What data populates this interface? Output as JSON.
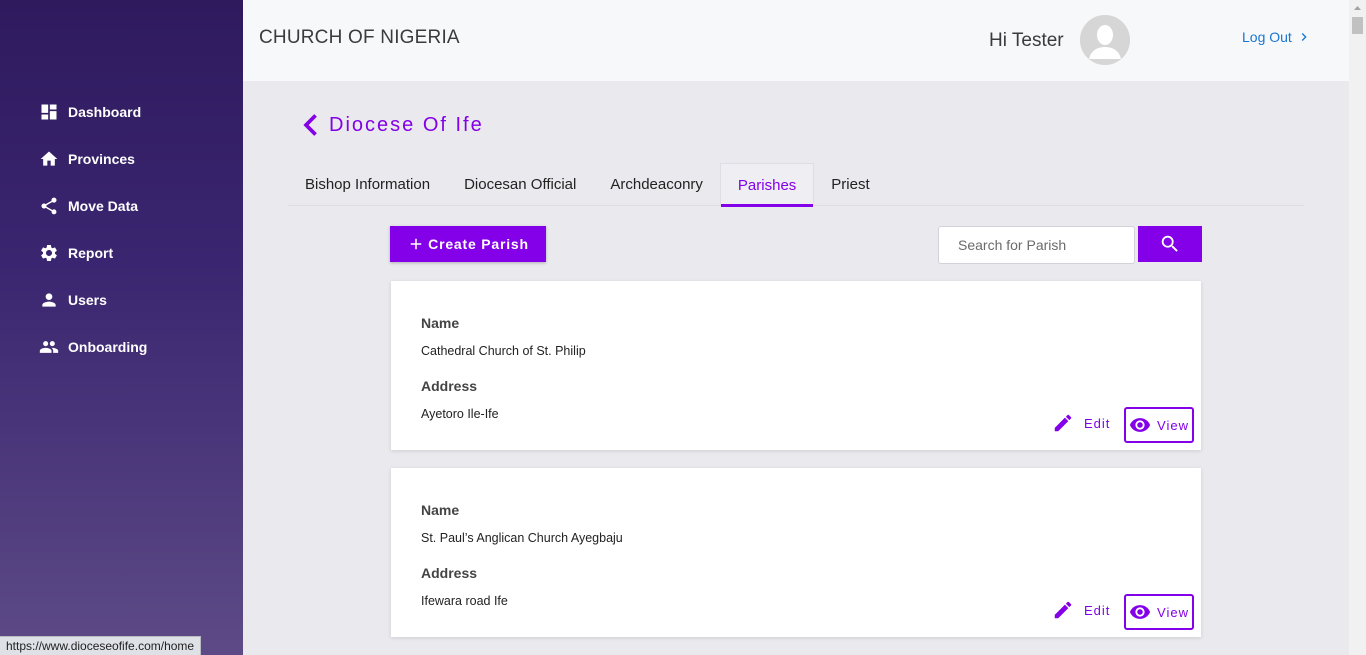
{
  "sidebar": {
    "items": [
      {
        "label": "Dashboard",
        "icon": "dashboard-icon"
      },
      {
        "label": "Provinces",
        "icon": "home-icon"
      },
      {
        "label": "Move Data",
        "icon": "share-icon"
      },
      {
        "label": "Report",
        "icon": "gear-icon"
      },
      {
        "label": "Users",
        "icon": "person-icon"
      },
      {
        "label": "Onboarding",
        "icon": "people-icon"
      }
    ]
  },
  "header": {
    "title": "CHURCH OF NIGERIA",
    "greeting": "Hi Tester",
    "logout_label": "Log Out"
  },
  "page": {
    "title": "Diocese Of Ife"
  },
  "tabs": [
    {
      "label": "Bishop Information",
      "active": false
    },
    {
      "label": "Diocesan Official",
      "active": false
    },
    {
      "label": "Archdeaconry",
      "active": false
    },
    {
      "label": "Parishes",
      "active": true
    },
    {
      "label": "Priest",
      "active": false
    }
  ],
  "toolbar": {
    "create_label": "Create Parish",
    "search_placeholder": "Search for Parish"
  },
  "parishes": [
    {
      "name_label": "Name",
      "name": "Cathedral Church of St. Philip",
      "address_label": "Address",
      "address": "Ayetoro Ile-Ife",
      "edit_label": "Edit",
      "view_label": "View"
    },
    {
      "name_label": "Name",
      "name": "St. Paul’s Anglican Church Ayegbaju",
      "address_label": "Address",
      "address": "Ifewara road Ife",
      "edit_label": "Edit",
      "view_label": "View"
    }
  ],
  "status_bar": {
    "url": "https://www.dioceseofife.com/home"
  },
  "colors": {
    "accent": "#8300e8",
    "link": "#1976d2",
    "sidebar_top": "#2f1a5e",
    "sidebar_bottom": "#5d4a86"
  }
}
